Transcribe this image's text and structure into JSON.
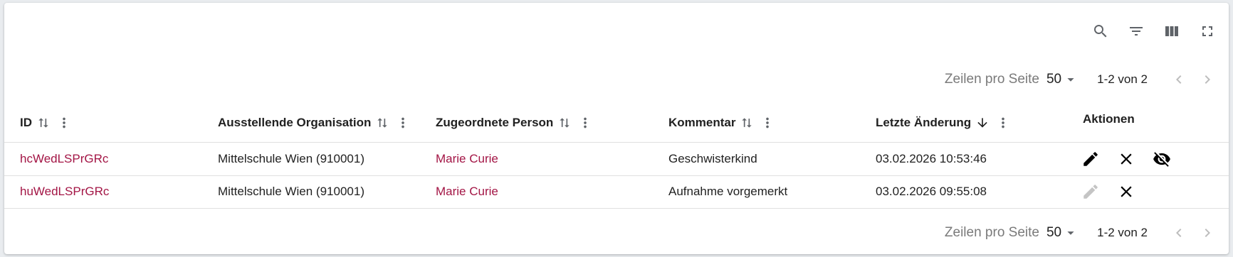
{
  "toolbar": {
    "icons": [
      "search-icon",
      "filter-list-icon",
      "view-column-icon",
      "fullscreen-icon"
    ]
  },
  "pagination": {
    "rows_per_page_label": "Zeilen pro Seite",
    "rows_per_page_value": "50",
    "range_text": "1-2 von 2"
  },
  "table": {
    "columns": [
      {
        "label": "ID",
        "sort": "unsorted"
      },
      {
        "label": "Ausstellende Organisation",
        "sort": "unsorted"
      },
      {
        "label": "Zugeordnete Person",
        "sort": "unsorted"
      },
      {
        "label": "Kommentar",
        "sort": "unsorted"
      },
      {
        "label": "Letzte Änderung",
        "sort": "descending"
      },
      {
        "label": "Aktionen"
      }
    ],
    "rows": [
      {
        "id": "hcWedLSPrGRc",
        "organisation": "Mittelschule Wien (910001)",
        "person": "Marie Curie",
        "comment": "Geschwisterkind",
        "last_changed": "03.02.2026 10:53:46",
        "actions": [
          "edit-icon",
          "close-icon",
          "visibility-off-icon"
        ]
      },
      {
        "id": "huWedLSPrGRc",
        "organisation": "Mittelschule Wien (910001)",
        "person": "Marie Curie",
        "comment": "Aufnahme vorgemerkt",
        "last_changed": "03.02.2026 09:55:08",
        "actions": [
          "edit-icon-disabled",
          "close-icon"
        ]
      }
    ]
  },
  "colors": {
    "link": "#a31545",
    "icon": "#5f6368",
    "disabled_icon": "#c4c4c4",
    "border": "#e0e0e0"
  }
}
